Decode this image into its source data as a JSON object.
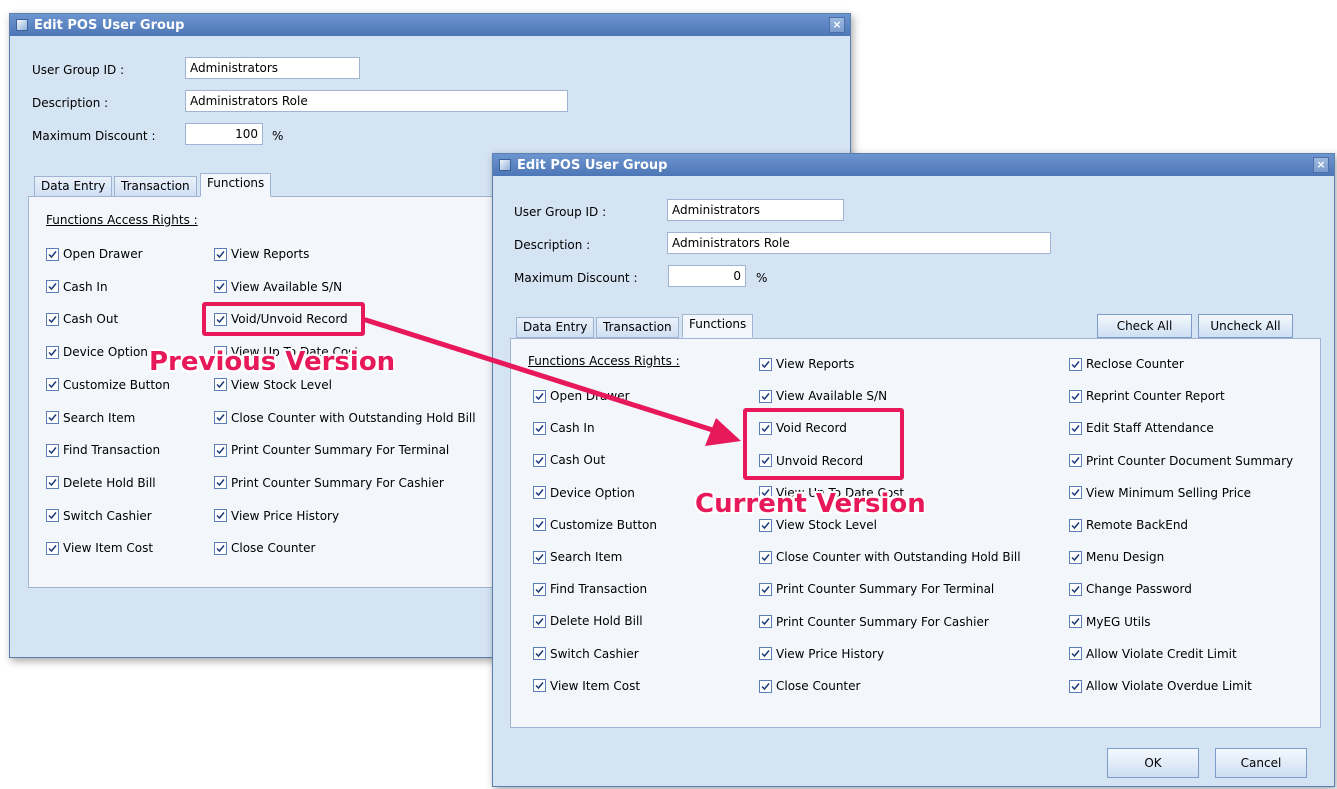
{
  "prev_window": {
    "title": "Edit POS User Group",
    "close_label": "×",
    "user_group_id_label": "User Group ID :",
    "user_group_id_value": "Administrators",
    "description_label": "Description :",
    "description_value": "Administrators Role",
    "max_discount_label": "Maximum Discount :",
    "max_discount_value": "100",
    "percent": "%",
    "tabs": [
      "Data Entry",
      "Transaction",
      "Functions"
    ],
    "section_title": "Functions Access Rights :",
    "col1": [
      "Open Drawer",
      "Cash In",
      "Cash Out",
      "Device Option",
      "Customize Button",
      "Search Item",
      "Find Transaction",
      "Delete Hold Bill",
      "Switch Cashier",
      "View Item Cost"
    ],
    "col2": [
      "View Reports",
      "View Available S/N",
      "Void/Unvoid Record",
      "View Up To Date Cost",
      "View Stock Level",
      "Close Counter with Outstanding Hold Bill",
      "Print Counter Summary For Terminal",
      "Print Counter Summary For Cashier",
      "View Price History",
      "Close Counter"
    ]
  },
  "cur_window": {
    "title": "Edit POS User Group",
    "close_label": "×",
    "user_group_id_label": "User Group ID :",
    "user_group_id_value": "Administrators",
    "description_label": "Description :",
    "description_value": "Administrators Role",
    "max_discount_label": "Maximum Discount :",
    "max_discount_value": "0",
    "percent": "%",
    "tabs": [
      "Data Entry",
      "Transaction",
      "Functions"
    ],
    "check_all": "Check All",
    "uncheck_all": "Uncheck All",
    "section_title": "Functions Access Rights :",
    "col1": [
      "Open Drawer",
      "Cash In",
      "Cash Out",
      "Device Option",
      "Customize Button",
      "Search Item",
      "Find Transaction",
      "Delete Hold Bill",
      "Switch Cashier",
      "View Item Cost"
    ],
    "col2": [
      "View Reports",
      "View Available S/N",
      "Void Record",
      "Unvoid Record",
      "View Up To Date Cost",
      "View Stock Level",
      "Close Counter with Outstanding Hold Bill",
      "Print Counter Summary For Terminal",
      "Print Counter Summary For Cashier",
      "View Price History",
      "Close Counter"
    ],
    "col3": [
      "Reclose Counter",
      "Reprint Counter Report",
      "Edit Staff Attendance",
      "Print Counter Document Summary",
      "View Minimum Selling Price",
      "Remote BackEnd",
      "Menu Design",
      "Change Password",
      "MyEG Utils",
      "Allow Violate Credit Limit",
      "Allow Violate Overdue Limit"
    ],
    "ok": "OK",
    "cancel": "Cancel"
  },
  "annotations": {
    "previous_version": "Previous Version",
    "current_version": "Current Version",
    "color": "#e8195b"
  }
}
